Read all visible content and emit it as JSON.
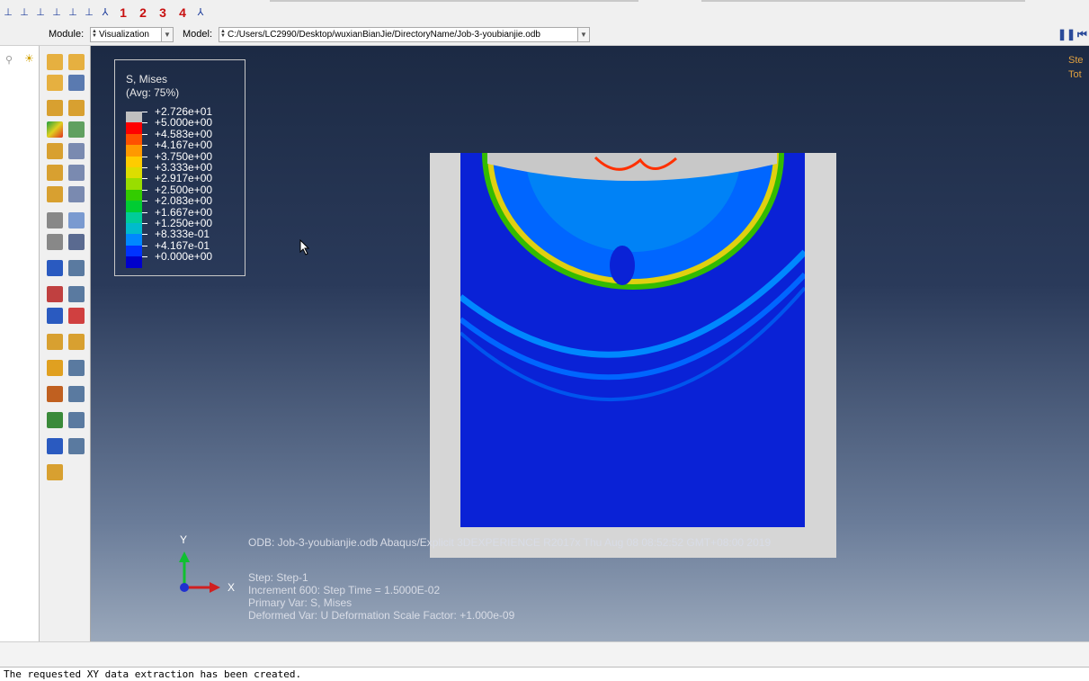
{
  "toolbar": {
    "view_numbers": [
      "1",
      "2",
      "3",
      "4"
    ]
  },
  "module_bar": {
    "module_label": "Module:",
    "module_value": "Visualization",
    "model_label": "Model:",
    "model_value": "C:/Users/LC2990/Desktop/wuxianBianJie/DirectoryName/Job-3-youbianjie.odb"
  },
  "legend": {
    "title_line1": "S, Mises",
    "title_line2": "(Avg: 75%)",
    "values": [
      "+2.726e+01",
      "+5.000e+00",
      "+4.583e+00",
      "+4.167e+00",
      "+3.750e+00",
      "+3.333e+00",
      "+2.917e+00",
      "+2.500e+00",
      "+2.083e+00",
      "+1.667e+00",
      "+1.250e+00",
      "+8.333e-01",
      "+4.167e-01",
      "+0.000e+00"
    ],
    "colors": [
      "#c0c0c0",
      "#ff0000",
      "#ff5000",
      "#ff9900",
      "#ffcc00",
      "#dddd00",
      "#99dd00",
      "#33cc00",
      "#00cc33",
      "#00cc99",
      "#00bbcc",
      "#0088ff",
      "#0033ff",
      "#0000cc"
    ]
  },
  "viewport": {
    "odb_line": "ODB: Job-3-youbianjie.odb    Abaqus/Explicit 3DEXPERIENCE R2017x    Thu Aug 08 08:52:52 GMT+08:00 2019",
    "step_line": "Step: Step-1",
    "increment_line": "Increment     600: Step Time =    1.5000E-02",
    "primary_var_line": "Primary Var: S, Mises",
    "deformed_var_line": "Deformed Var: U   Deformation Scale Factor: +1.000e-09",
    "axis_y": "Y",
    "axis_x": "X",
    "side_text_1": "Ste",
    "side_text_2": "Tot"
  },
  "message_area": {
    "text": "The requested XY data extraction has been created."
  }
}
